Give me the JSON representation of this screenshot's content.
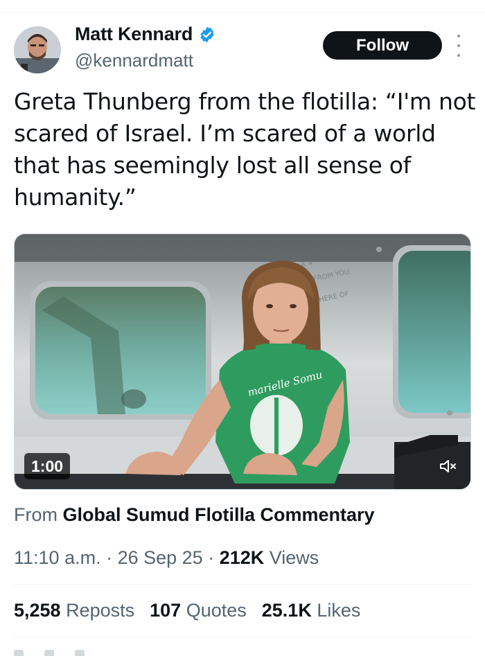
{
  "author": {
    "name": "Matt Kennard",
    "handle": "@kennardmatt",
    "verified": true,
    "verified_color": "#1d9bf0"
  },
  "actions": {
    "follow_label": "Follow",
    "more_icon": "more-vertical-icon"
  },
  "tweet": {
    "text": "Greta Thunberg from the flotilla: “I'm not scared of Israel. I’m scared of a world that has seemingly lost all sense of humanity.”"
  },
  "media": {
    "duration": "1:00",
    "shirt_text": "marielle Somu",
    "mute_icon": "speaker-muted-icon"
  },
  "source": {
    "prefix": "From",
    "name": "Global Sumud Flotilla Commentary"
  },
  "meta": {
    "time": "11:10 a.m.",
    "sep1": " · ",
    "date": "26 Sep 25",
    "sep2": " · ",
    "views_count": "212K",
    "views_label": " Views"
  },
  "stats": {
    "reposts_count": "5,258",
    "reposts_label": " Reposts",
    "quotes_count": "107",
    "quotes_label": " Quotes",
    "likes_count": "25.1K",
    "likes_label": " Likes"
  },
  "colors": {
    "text_primary": "#0f1419",
    "text_secondary": "#536471",
    "button_bg": "#0f1419"
  }
}
